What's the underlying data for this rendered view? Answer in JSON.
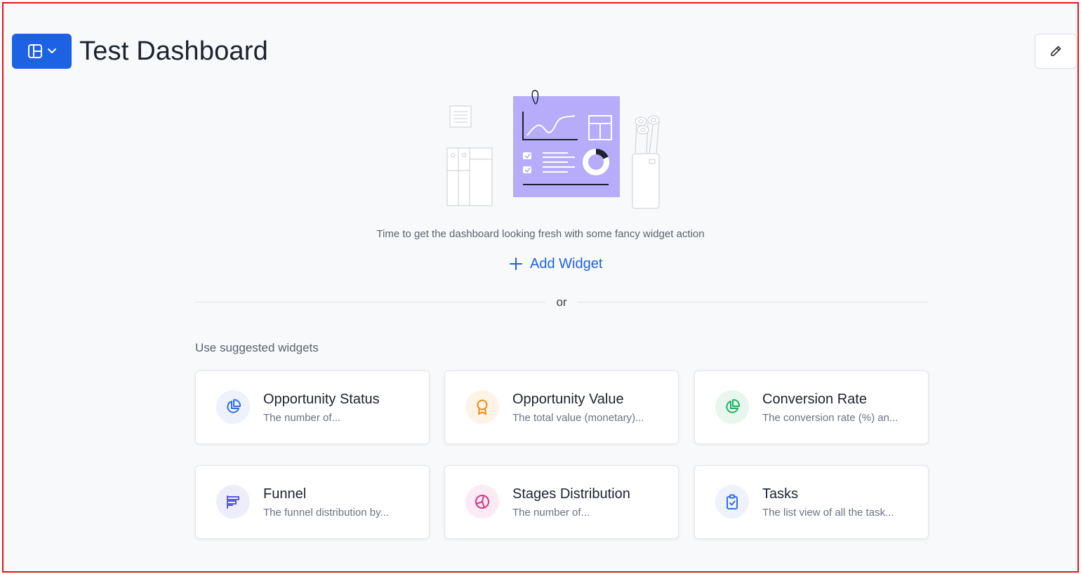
{
  "header": {
    "title": "Test Dashboard",
    "layout_button_icon": "layout-grid-icon",
    "edit_button_icon": "pencil-icon"
  },
  "empty_state": {
    "message": "Time to get the dashboard looking fresh with some fancy widget action",
    "add_widget_label": "Add Widget",
    "or_label": "or",
    "suggested_label": "Use suggested widgets"
  },
  "widgets": [
    {
      "title": "Opportunity Status",
      "description": "The number of...",
      "icon": "pie-chart-icon",
      "color": "#2f6fe0",
      "bg": "#edf2fc"
    },
    {
      "title": "Opportunity Value",
      "description": "The total value (monetary)...",
      "icon": "award-icon",
      "color": "#f08a0e",
      "bg": "#fdf4e7"
    },
    {
      "title": "Conversion Rate",
      "description": "The conversion rate (%) an...",
      "icon": "pie-chart-icon",
      "color": "#1bb162",
      "bg": "#e7f7ee"
    },
    {
      "title": "Funnel",
      "description": "The funnel distribution by...",
      "icon": "funnel-bars-icon",
      "color": "#5a5bd8",
      "bg": "#eeeefb"
    },
    {
      "title": "Stages Distribution",
      "description": "The number of...",
      "icon": "pie-segments-icon",
      "color": "#d9368b",
      "bg": "#fcebf4"
    },
    {
      "title": "Tasks",
      "description": "The list view of all the task...",
      "icon": "clipboard-check-icon",
      "color": "#2f6fe0",
      "bg": "#edf2fc"
    }
  ],
  "colors": {
    "accent": "#1c62e3",
    "frame_border": "#e0161b",
    "illustration_panel": "#b6acfa"
  }
}
